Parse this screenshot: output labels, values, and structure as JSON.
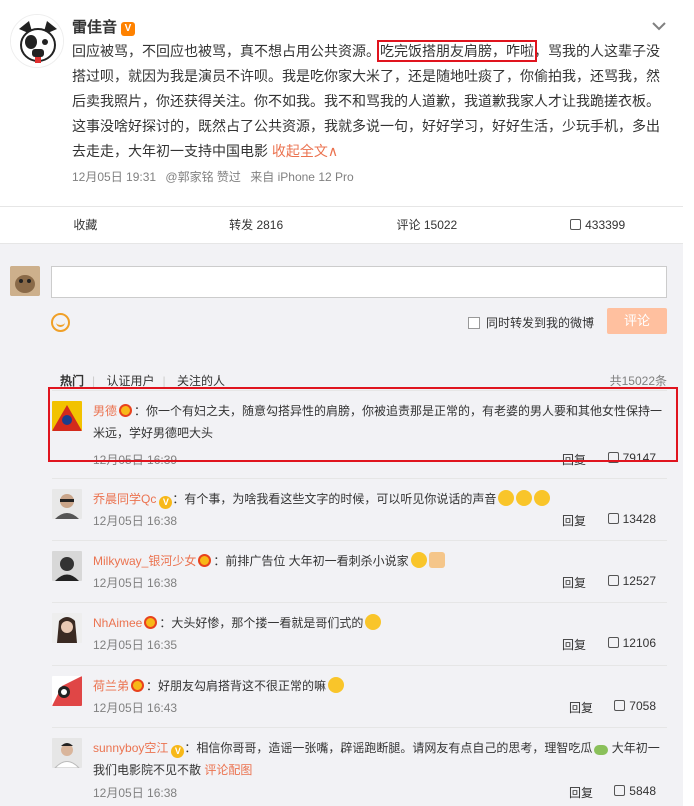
{
  "post": {
    "author": "雷佳音",
    "verified_badge": "V",
    "menu_icon": "chevron-down-icon",
    "text_before": "回应被骂，不回应也被骂，真不想占用公共资源。",
    "text_highlight": "吃完饭搭朋友肩膀，咋啦",
    "text_after": "，骂我的人这辈子没搭过呗，就因为我是演员不许呗。我是吃你家大米了，还是随地吐痰了，你偷拍我，还骂我，然后卖我照片，你还获得关注。你不如我。我不和骂我的人道歉，我道歉我家人才让我跪搓衣板。这事没啥好探讨的，既然占了公共资源，我就多说一句，好好学习，好好生活，少玩手机，多出去走走，大年初一支持中国电影",
    "collapse_link": "收起全文∧",
    "meta_time": "12月05日 19:31",
    "meta_liker": "@郭家铭 赞过",
    "meta_source": "来自 iPhone 12 Pro"
  },
  "actions": {
    "favorite": "收藏",
    "repost": "转发 2816",
    "comment": "评论 15022",
    "like": "433399"
  },
  "composer": {
    "emoji_icon": "smile-icon",
    "forward_label": "同时转发到我的微博",
    "submit_label": "评论"
  },
  "comment_tabs": {
    "hot": "热门",
    "verified": "认证用户",
    "following": "关注的人",
    "total": "共15022条"
  },
  "comments": [
    {
      "user": "男德",
      "text": "：你一个有妇之夫，随意勾搭异性的肩膀，你被追责那是正常的，有老婆的男人要和其他女性保持一米远，学好男德吧大头",
      "time": "12月05日 16:39",
      "reply": "回复",
      "likes": "79147"
    },
    {
      "user": "乔晨同学Qc",
      "text": "：有个事，为啥我看这些文字的时候，可以听见你说话的声音",
      "time": "12月05日 16:38",
      "reply": "回复",
      "likes": "13428"
    },
    {
      "user": "Milkyway_银河少女",
      "text": "：前排广告位 大年初一看刺杀小说家",
      "time": "12月05日 16:38",
      "reply": "回复",
      "likes": "12527"
    },
    {
      "user": "NhAimee",
      "text": "：大头好惨，那个搂一看就是哥们式的",
      "time": "12月05日 16:35",
      "reply": "回复",
      "likes": "12106"
    },
    {
      "user": "荷兰弟",
      "text": "：好朋友勾肩搭背这不很正常的嘛",
      "time": "12月05日 16:43",
      "reply": "回复",
      "likes": "7058"
    },
    {
      "user": "sunnyboy空江",
      "text": "：相信你哥哥，造谣一张嘴，辟谣跑断腿。请网友有点自己的思考，理智吃瓜",
      "text2": " 大年初一我们电影院不见不散 ",
      "link": "评论配图",
      "time": "12月05日 16:38",
      "reply": "回复",
      "likes": "5848"
    }
  ]
}
